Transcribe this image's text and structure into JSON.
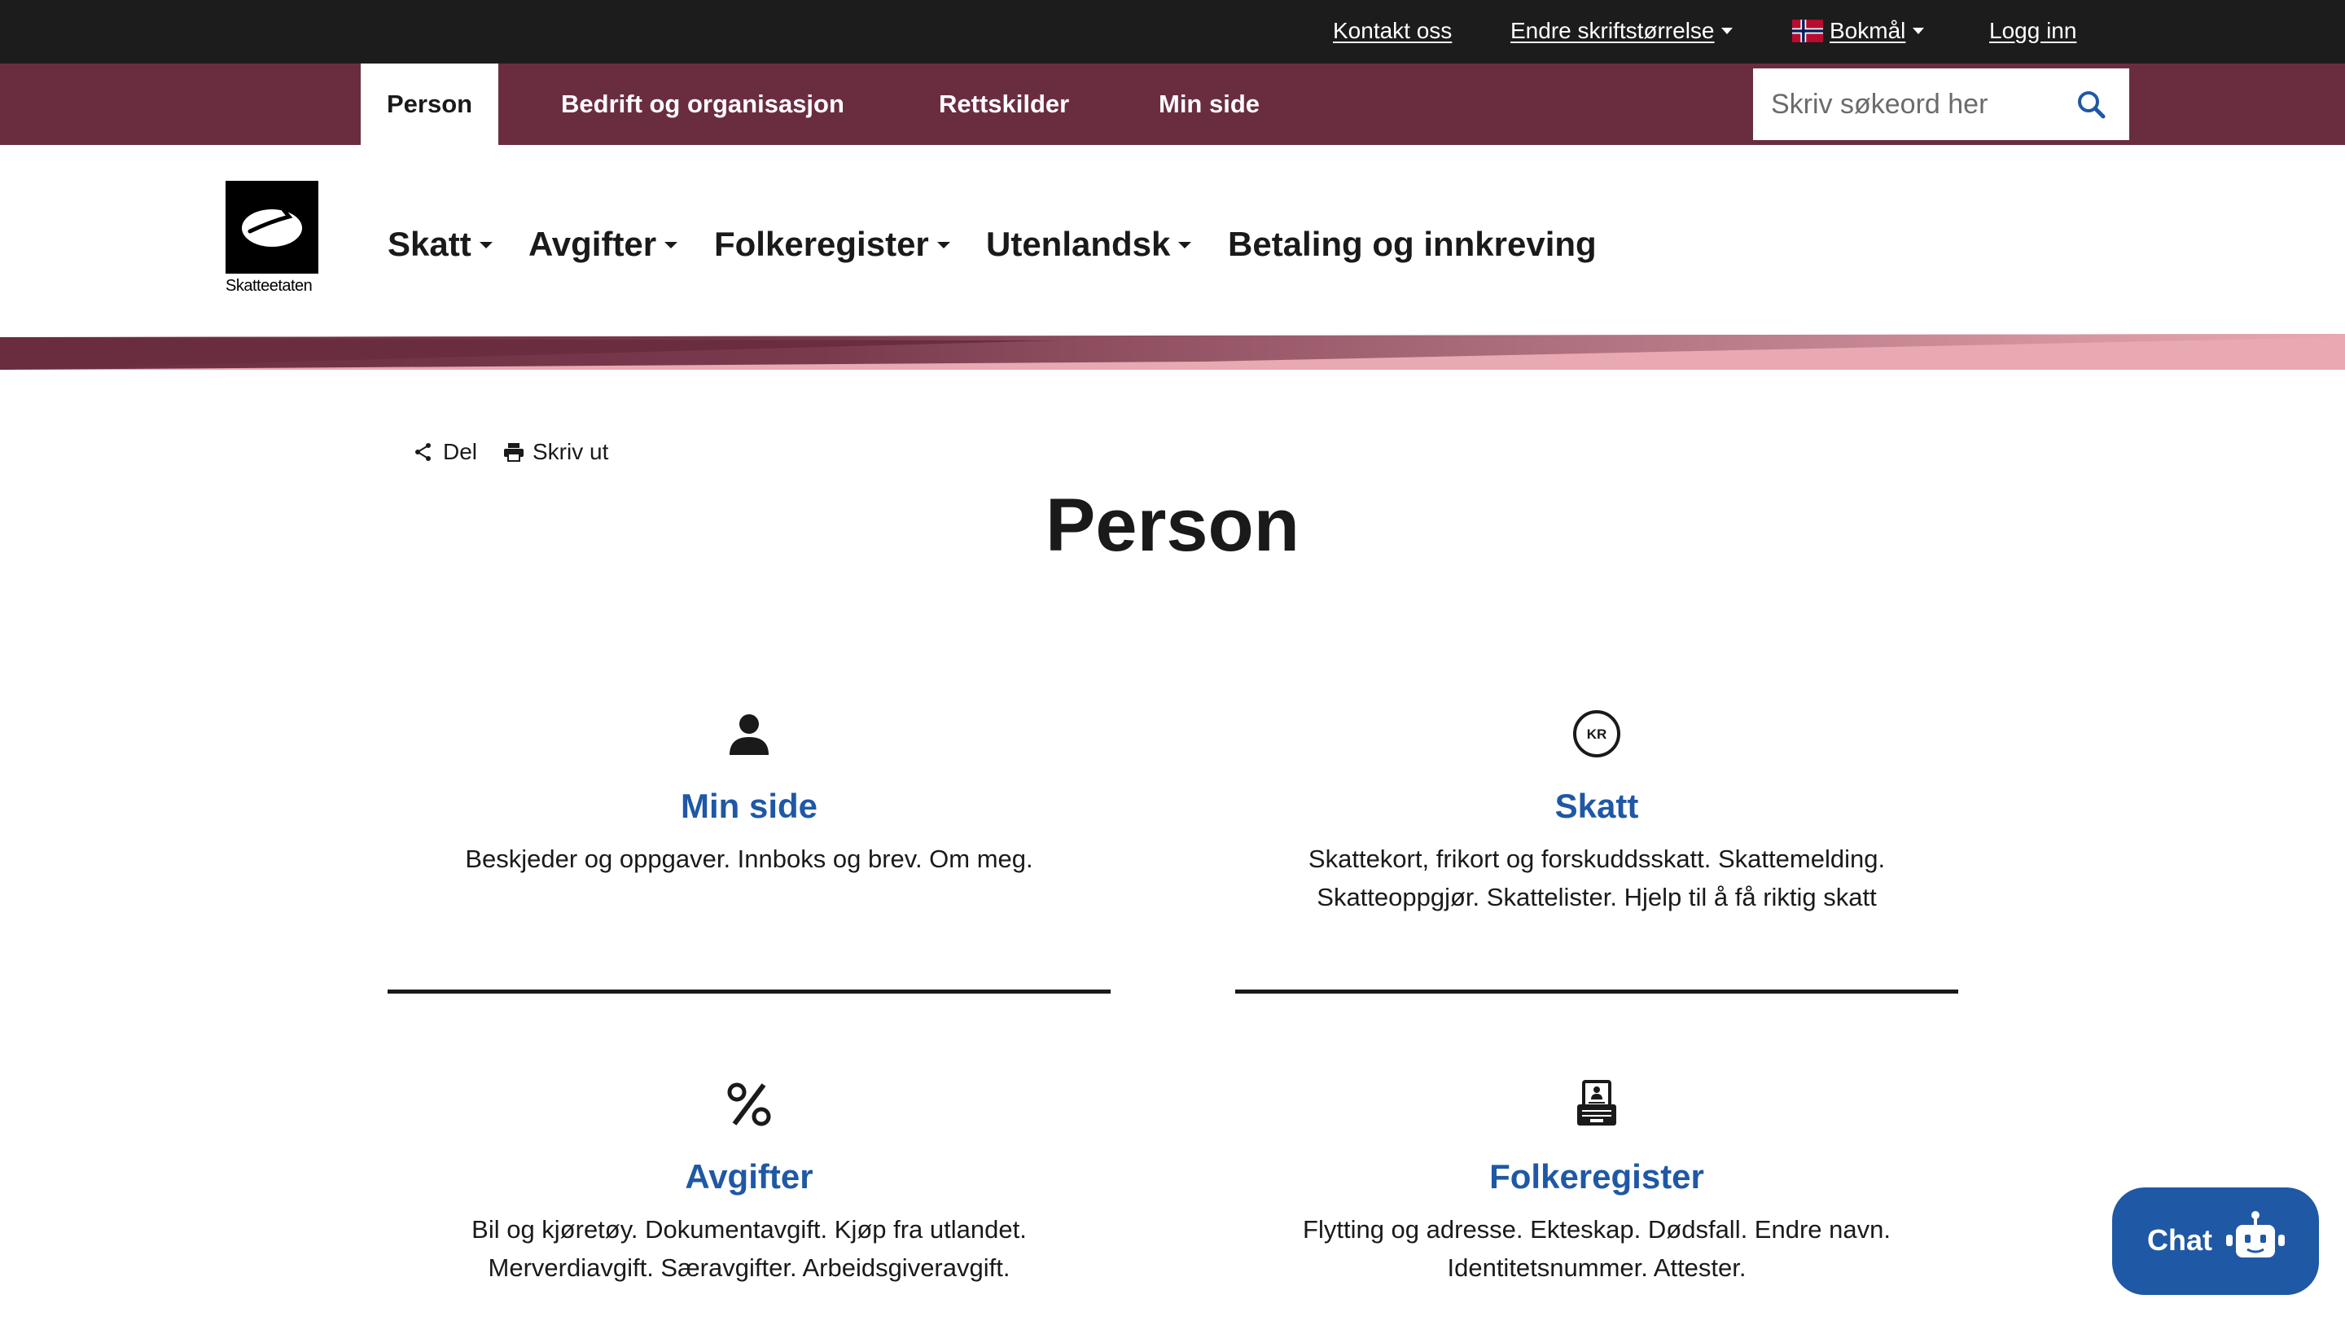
{
  "utility": {
    "contact": "Kontakt oss",
    "font_size": "Endre skriftstørrelse",
    "language": "Bokmål",
    "login": "Logg inn"
  },
  "sections": {
    "person": "Person",
    "business": "Bedrift og organisasjon",
    "legal_sources": "Rettskilder",
    "my_page": "Min side"
  },
  "search": {
    "placeholder": "Skriv søkeord her",
    "icon": "search-icon"
  },
  "logo": {
    "text": "Skatteetaten",
    "icon": "skatteetaten-logo"
  },
  "main_nav": {
    "tax": "Skatt",
    "fees": "Avgifter",
    "registry": "Folkeregister",
    "abroad": "Utenlandsk",
    "payment": "Betaling og innkreving"
  },
  "page_actions": {
    "share": "Del",
    "print": "Skriv ut"
  },
  "page": {
    "title": "Person"
  },
  "cards": [
    {
      "icon": "person-icon",
      "title": "Min side",
      "desc_line1": "Beskjeder og oppgaver. Innboks og brev. Om meg.",
      "desc_line2": ""
    },
    {
      "icon": "kr-coin-icon",
      "icon_text": "KR",
      "title": "Skatt",
      "desc_line1": "Skattekort, frikort og forskuddsskatt. Skattemelding.",
      "desc_line2": "Skatteoppgjør. Skattelister. Hjelp til å få riktig skatt"
    },
    {
      "icon": "percent-icon",
      "title": "Avgifter",
      "desc_line1": "Bil og kjøretøy. Dokumentavgift. Kjøp fra utlandet.",
      "desc_line2": "Merverdiavgift. Særavgifter. Arbeidsgiveravgift."
    },
    {
      "icon": "registry-icon",
      "title": "Folkeregister",
      "desc_line1": "Flytting og adresse. Ekteskap. Dødsfall. Endre navn.",
      "desc_line2": "Identitetsnummer. Attester."
    }
  ],
  "chat": {
    "label": "Chat",
    "icon": "chatbot-icon"
  },
  "colors": {
    "utility_bar": "#1c1c1c",
    "section_bar": "#6a2d40",
    "band_light": "#e8a9b2",
    "link_blue": "#1f58a5",
    "chat_button": "#1f58a5"
  }
}
